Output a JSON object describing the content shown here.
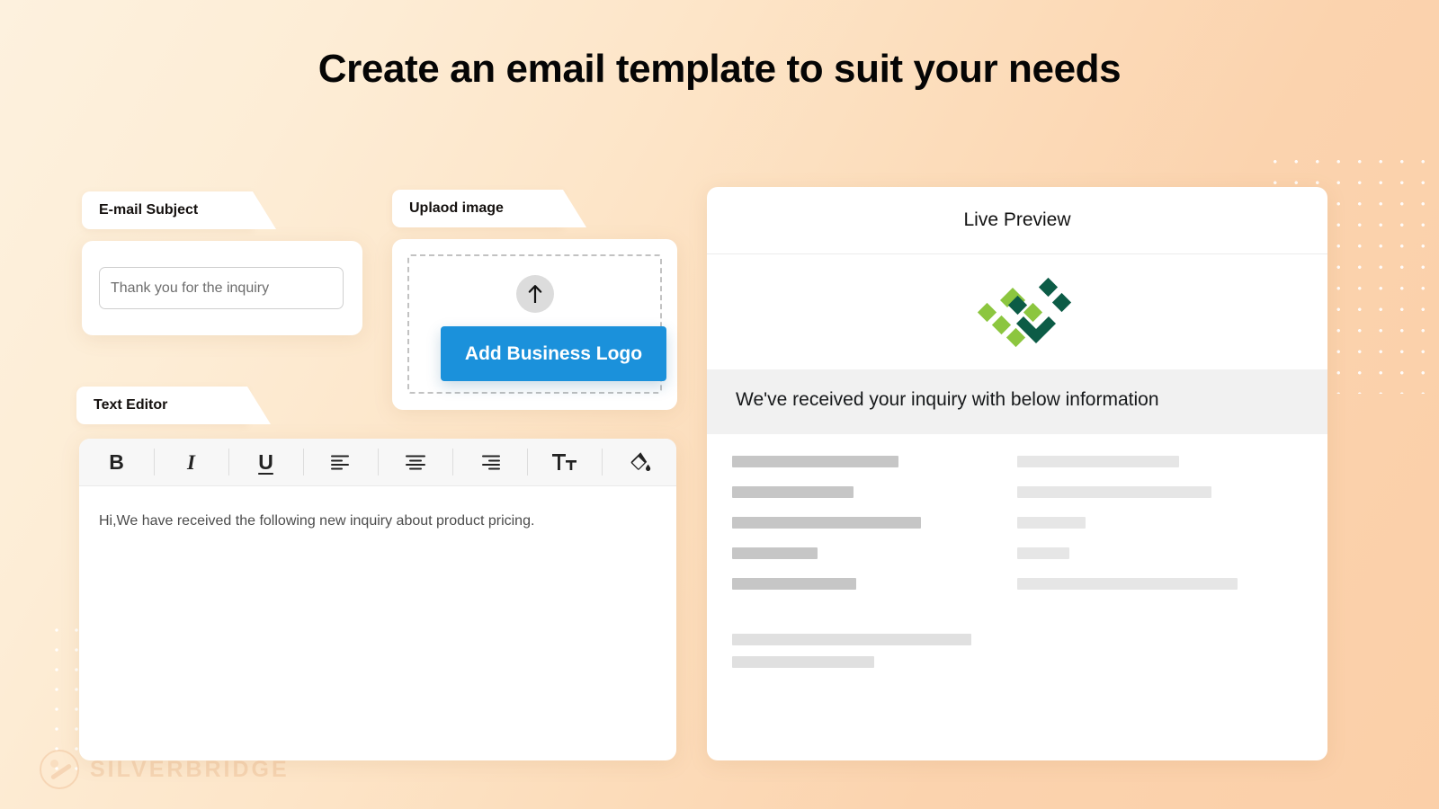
{
  "page": {
    "title": "Create an email template to suit your needs",
    "watermark_text": "SILVERBRIDGE",
    "accent_blue": "#1b91db",
    "background_from": "#fdf1de",
    "background_to": "#fbcfa8"
  },
  "subject_panel": {
    "label": "E-mail Subject",
    "input_placeholder": "Thank you for the inquiry",
    "input_value": ""
  },
  "upload_panel": {
    "label": "Uplaod image",
    "upload_icon": "arrow-up-icon",
    "button_label": "Add Business Logo"
  },
  "editor_panel": {
    "label": "Text Editor",
    "toolbar": [
      {
        "name": "bold-button",
        "glyph": "B",
        "style": "b"
      },
      {
        "name": "italic-button",
        "glyph": "I",
        "style": "i"
      },
      {
        "name": "underline-button",
        "glyph": "U",
        "style": "u"
      },
      {
        "name": "align-left-button",
        "glyph": "",
        "style": "align-left"
      },
      {
        "name": "align-center-button",
        "glyph": "",
        "style": "align-center"
      },
      {
        "name": "align-right-button",
        "glyph": "",
        "style": "align-right"
      },
      {
        "name": "font-size-button",
        "glyph": "",
        "style": "font-size"
      },
      {
        "name": "fill-color-button",
        "glyph": "",
        "style": "fill"
      }
    ],
    "body_text": "Hi,We have received the following new inquiry about product pricing."
  },
  "preview_panel": {
    "title": "Live Preview",
    "logo_name": "diamond-grid-logo",
    "logo_colors": {
      "light": "#8cc63f",
      "dark": "#0c5c46",
      "mid": "#1e7a52"
    },
    "banner_text": "We've received your inquiry with below information",
    "skeleton_rows": [
      {
        "left_width": 185,
        "right_width": 180
      },
      {
        "left_width": 135,
        "right_width": 216
      },
      {
        "left_width": 210,
        "right_width": 76
      },
      {
        "left_width": 95,
        "right_width": 58
      },
      {
        "left_width": 138,
        "right_width": 245
      }
    ],
    "skeleton_tail": [
      266,
      158
    ]
  }
}
